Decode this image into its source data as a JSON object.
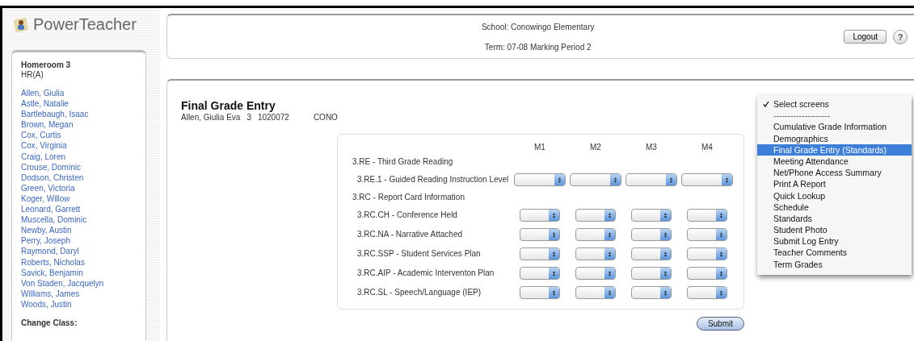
{
  "app": {
    "logo_text": "PowerTeacher"
  },
  "sidebar": {
    "class_title": "Homeroom 3",
    "section": "HR(A)",
    "students": [
      "Allen, Giulia",
      "Astle, Natalie",
      "Bartlebaugh, Isaac",
      "Brown, Megan",
      "Cox, Curtis",
      "Cox, Virginia",
      "Craig, Loren",
      "Crouse, Dominic",
      "Dodson, Christen",
      "Green, Victoria",
      "Koger, Willow",
      "Leonard, Garrett",
      "Muscella, Dominic",
      "Newby, Austin",
      "Perry, Joseph",
      "Raymond, Daryl",
      "Roberts, Nicholas",
      "Savick, Benjamin",
      "Von Staden, Jacquelyn",
      "Williams, James",
      "Woods, Justin"
    ],
    "change_class_label": "Change Class:"
  },
  "header": {
    "school": "School: Conowingo Elementary",
    "term": "Term: 07-08 Marking Period 2",
    "logout_button": "Logout",
    "help_button": "?"
  },
  "page": {
    "title": "Final Grade Entry",
    "student": {
      "name": "Allen, Giulia Eva",
      "grade": "3",
      "id": "1020072",
      "school_code": "CONO"
    }
  },
  "grades_form": {
    "columns": [
      "M1",
      "M2",
      "M3",
      "M4"
    ],
    "rows": [
      {
        "kind": "group",
        "label": "3.RE - Third Grade Reading"
      },
      {
        "kind": "standard",
        "label": "3.RE.1 - Guided Reading Instruction Level"
      },
      {
        "kind": "group",
        "label": "3.RC - Report Card Information"
      },
      {
        "kind": "standard",
        "label": "3.RC.CH - Conference Held"
      },
      {
        "kind": "standard",
        "label": "3.RC.NA - Narrative Attached"
      },
      {
        "kind": "standard",
        "label": "3.RC.SSP - Student Services Plan"
      },
      {
        "kind": "standard",
        "label": "3.RC.AIP - Academic Interventon Plan"
      },
      {
        "kind": "standard",
        "label": "3.RC.SL - Speech/Language (IEP)"
      }
    ],
    "submit_button": "Submit"
  },
  "screens_menu": {
    "items": [
      {
        "kind": "option",
        "label": "Select screens",
        "checked": true,
        "selected": false
      },
      {
        "kind": "separator",
        "label": "--------------------"
      },
      {
        "kind": "option",
        "label": "Cumulative Grade Information",
        "checked": false,
        "selected": false
      },
      {
        "kind": "option",
        "label": "Demographics",
        "checked": false,
        "selected": false
      },
      {
        "kind": "option",
        "label": "Final Grade Entry (Standards)",
        "checked": false,
        "selected": true
      },
      {
        "kind": "option",
        "label": "Meeting Attendance",
        "checked": false,
        "selected": false
      },
      {
        "kind": "option",
        "label": "Net/Phone Access Summary",
        "checked": false,
        "selected": false
      },
      {
        "kind": "option",
        "label": "Print A Report",
        "checked": false,
        "selected": false
      },
      {
        "kind": "option",
        "label": "Quick Lookup",
        "checked": false,
        "selected": false
      },
      {
        "kind": "option",
        "label": "Schedule",
        "checked": false,
        "selected": false
      },
      {
        "kind": "option",
        "label": "Standards",
        "checked": false,
        "selected": false
      },
      {
        "kind": "option",
        "label": "Student Photo",
        "checked": false,
        "selected": false
      },
      {
        "kind": "option",
        "label": "Submit Log Entry",
        "checked": false,
        "selected": false
      },
      {
        "kind": "option",
        "label": "Teacher Comments",
        "checked": false,
        "selected": false
      },
      {
        "kind": "option",
        "label": "Term Grades",
        "checked": false,
        "selected": false
      }
    ]
  }
}
